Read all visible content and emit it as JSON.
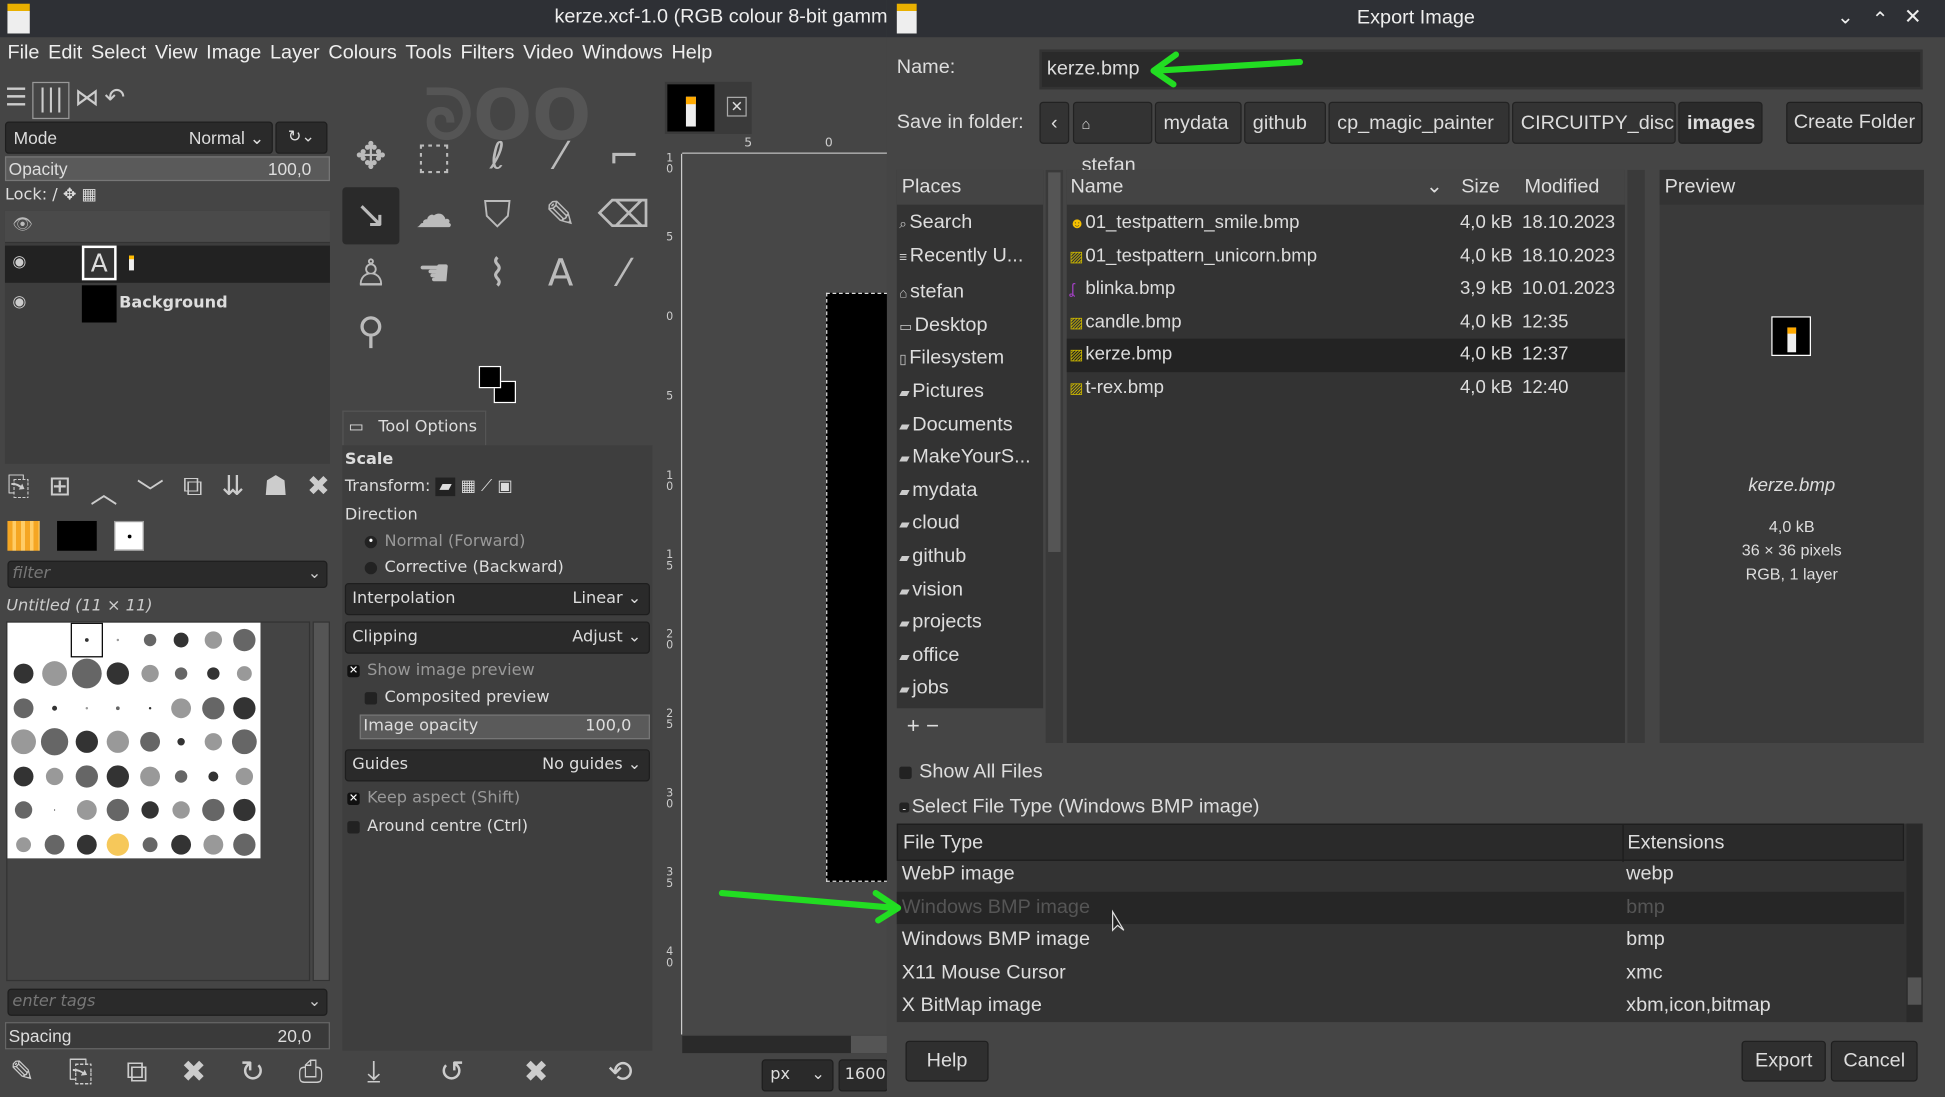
{
  "gimp": {
    "window_title": "kerze.xcf-1.0 (RGB colour 8-bit gamma",
    "menu": [
      "File",
      "Edit",
      "Select",
      "View",
      "Image",
      "Layer",
      "Colours",
      "Tools",
      "Filters",
      "Video",
      "Windows",
      "Help"
    ],
    "layers": {
      "mode_label": "Mode",
      "mode_value": "Normal",
      "opacity_label": "Opacity",
      "opacity_value": "100,0",
      "lock_label": "Lock:",
      "items": [
        {
          "name": ""
        },
        {
          "name": "Background"
        }
      ]
    },
    "brushes": {
      "filter_placeholder": "filter",
      "current_brush": "Untitled (11 × 11)",
      "tags_placeholder": "enter tags",
      "spacing_label": "Spacing",
      "spacing_value": "20,0"
    },
    "tool_options": {
      "tab_label": "Tool Options",
      "tool_name": "Scale",
      "transform_label": "Transform:",
      "direction_label": "Direction",
      "direction_options": [
        "Normal (Forward)",
        "Corrective (Backward)"
      ],
      "direction_selected": 0,
      "interpolation_label": "Interpolation",
      "interpolation_value": "Linear",
      "clipping_label": "Clipping",
      "clipping_value": "Adjust",
      "show_preview": "Show image preview",
      "show_preview_checked": true,
      "composited_preview": "Composited preview",
      "composited_checked": false,
      "image_opacity_label": "Image opacity",
      "image_opacity_value": "100,0",
      "guides_label": "Guides",
      "guides_value": "No guides",
      "keep_aspect": "Keep aspect (Shift)",
      "keep_aspect_checked": true,
      "around_centre": "Around centre (Ctrl)",
      "around_centre_checked": false
    },
    "canvas": {
      "ruler_top": [
        "0",
        "5",
        "0"
      ],
      "ruler_left": [
        "10",
        "5",
        "0",
        "5",
        "10",
        "15",
        "20",
        "25",
        "30",
        "35",
        "40"
      ],
      "unit": "px",
      "zoom": "1600"
    }
  },
  "dialog": {
    "title": "Export Image",
    "name_label": "Name:",
    "name_value": "kerze.bmp",
    "folder_label": "Save in folder:",
    "breadcrumbs": [
      "stefan",
      "mydata",
      "github",
      "cp_magic_painter",
      "CIRCUITPY_disc",
      "images"
    ],
    "create_folder": "Create Folder",
    "places_header": "Places",
    "places": [
      "Search",
      "Recently U...",
      "stefan",
      "Desktop",
      "Filesystem",
      "Pictures",
      "Documents",
      "MakeYourS...",
      "mydata",
      "cloud",
      "github",
      "vision",
      "projects",
      "office",
      "jobs"
    ],
    "columns": {
      "name": "Name",
      "size": "Size",
      "modified": "Modified"
    },
    "files": [
      {
        "name": "01_testpattern_smile.bmp",
        "size": "4,0 kB",
        "modified": "18.10.2023",
        "icon": "smiley-icon"
      },
      {
        "name": "01_testpattern_unicorn.bmp",
        "size": "4,0 kB",
        "modified": "18.10.2023",
        "icon": "image-file-icon"
      },
      {
        "name": "blinka.bmp",
        "size": "3,9 kB",
        "modified": "10.01.2023",
        "icon": "snake-icon"
      },
      {
        "name": "candle.bmp",
        "size": "4,0 kB",
        "modified": "12:35",
        "icon": "image-file-icon"
      },
      {
        "name": "kerze.bmp",
        "size": "4,0 kB",
        "modified": "12:37",
        "icon": "image-file-icon",
        "selected": true
      },
      {
        "name": "t-rex.bmp",
        "size": "4,0 kB",
        "modified": "12:40",
        "icon": "image-file-icon"
      }
    ],
    "preview": {
      "header": "Preview",
      "filename": "kerze.bmp",
      "size": "4,0 kB",
      "dimensions": "36 × 36 pixels",
      "mode": "RGB, 1 layer"
    },
    "show_all_files": "Show All Files",
    "select_file_type": "Select File Type (Windows BMP image)",
    "filetype_columns": {
      "type": "File Type",
      "ext": "Extensions"
    },
    "filetypes": [
      {
        "type": "WebP image",
        "ext": "webp"
      },
      {
        "type": "Windows BMP image",
        "ext": "bmp",
        "hover": true
      },
      {
        "type": "Windows BMP image",
        "ext": "bmp"
      },
      {
        "type": "X11 Mouse Cursor",
        "ext": "xmc"
      },
      {
        "type": "X BitMap image",
        "ext": "xbm,icon,bitmap"
      }
    ],
    "help": "Help",
    "export": "Export",
    "cancel": "Cancel"
  },
  "annotation_color": "#22dd22"
}
